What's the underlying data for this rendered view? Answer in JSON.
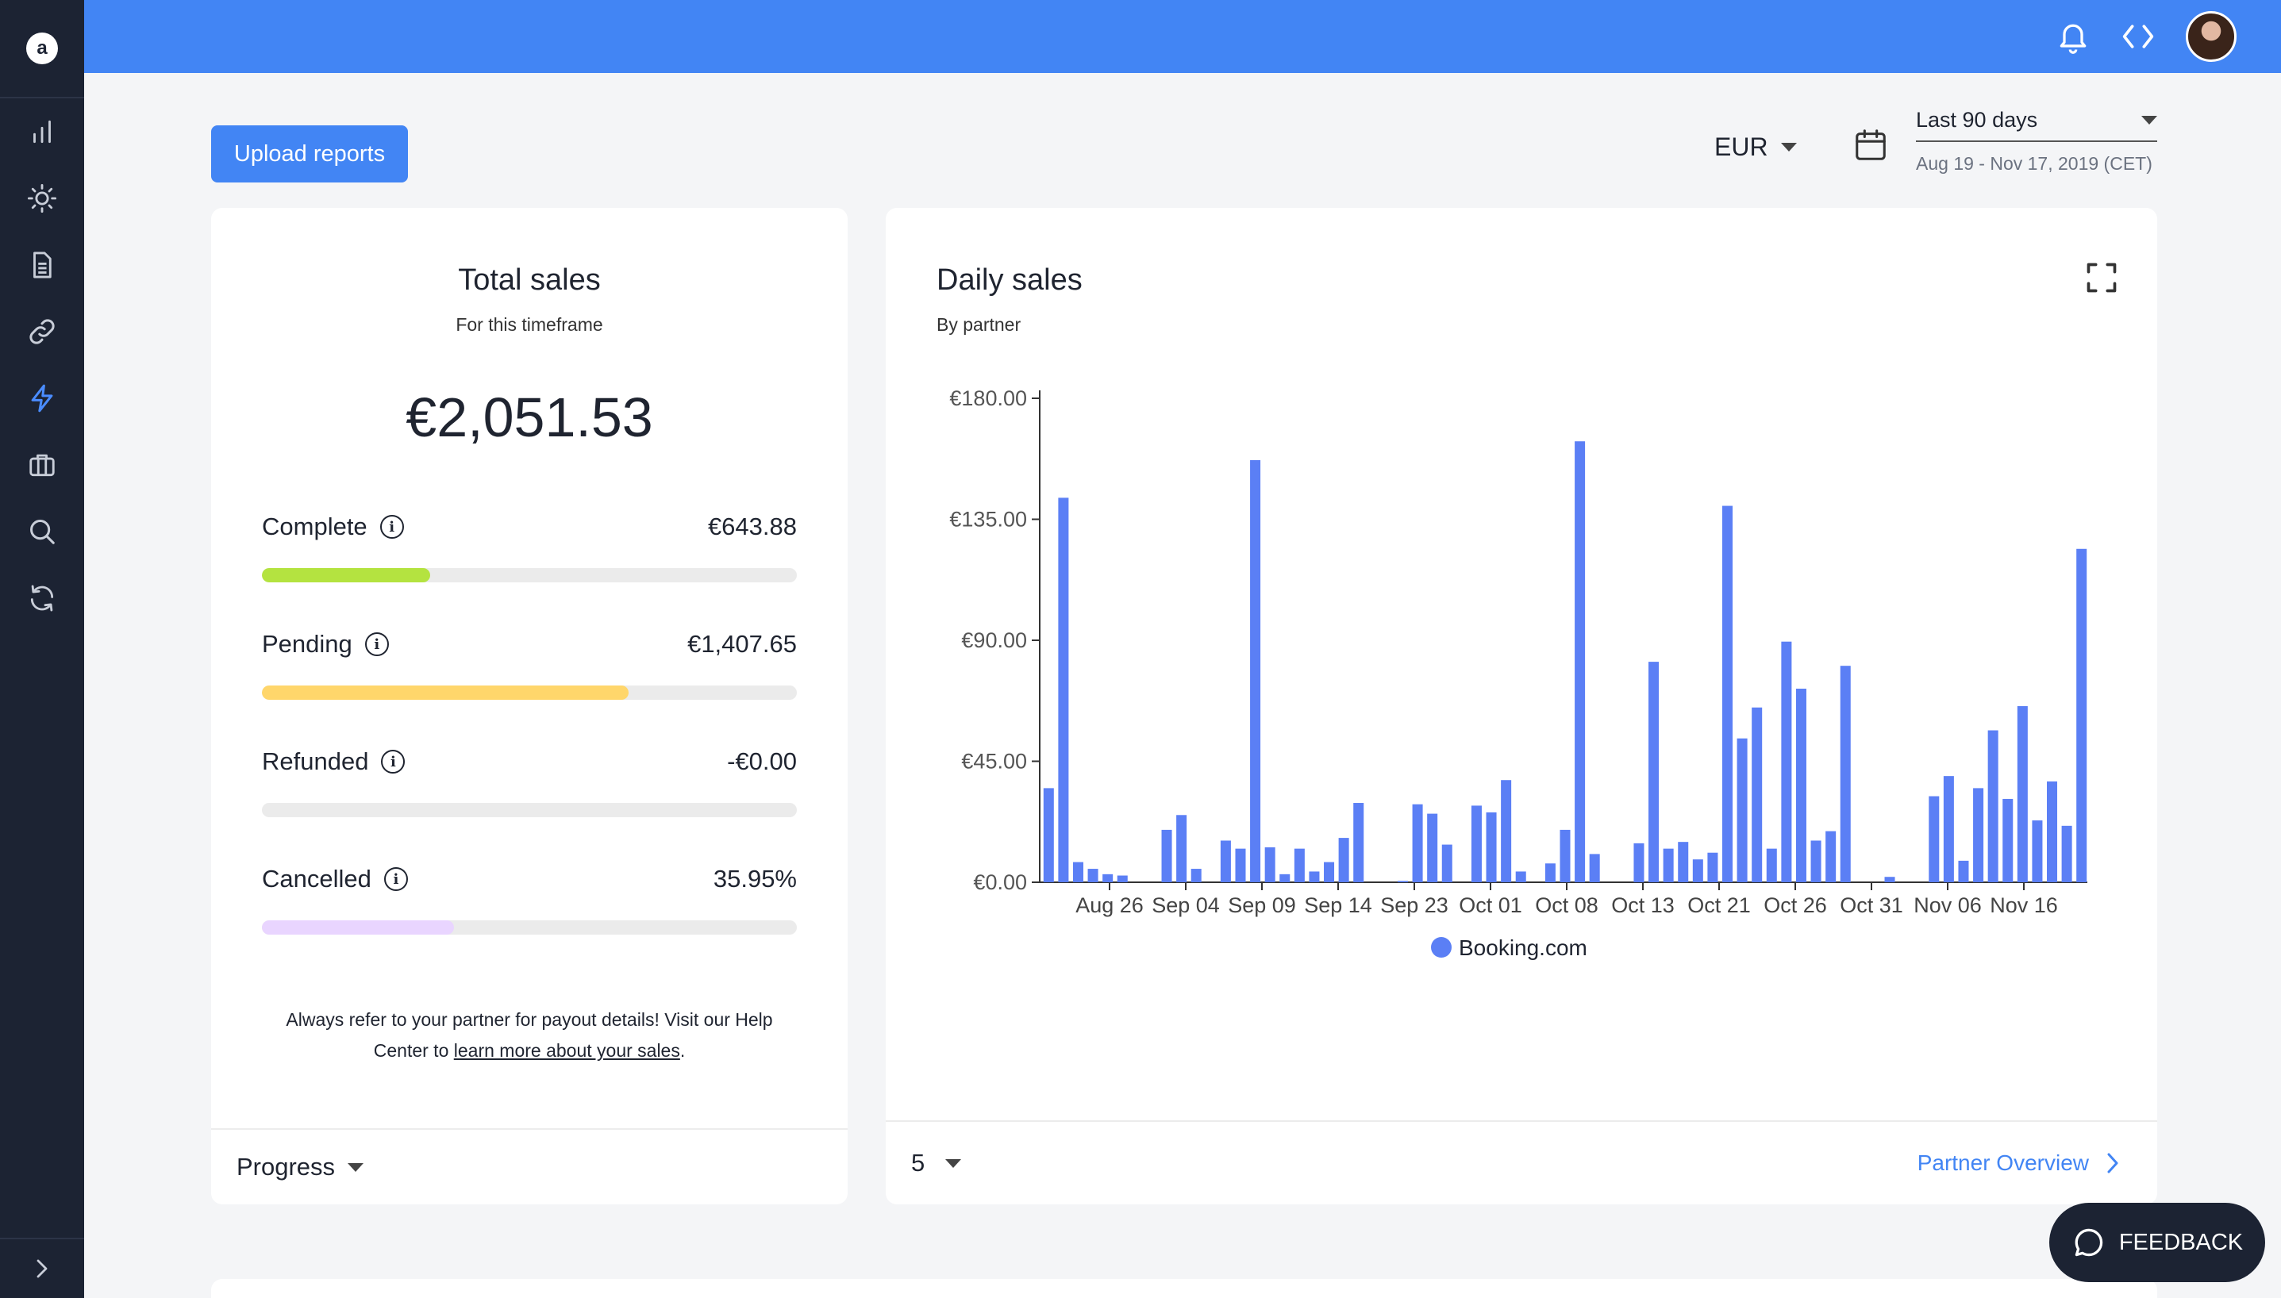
{
  "sidebar": {
    "logo": "a",
    "items": [
      {
        "icon": "bar-chart-icon"
      },
      {
        "icon": "sun-icon"
      },
      {
        "icon": "document-icon"
      },
      {
        "icon": "link-icon"
      },
      {
        "icon": "lightning-icon",
        "active": true
      },
      {
        "icon": "briefcase-icon"
      },
      {
        "icon": "search-icon"
      },
      {
        "icon": "refresh-icon"
      }
    ],
    "expand_icon": "chevron-right-icon"
  },
  "topbar": {
    "icons": [
      "bell-icon",
      "code-icon"
    ],
    "accent": "#4285f4"
  },
  "toolbar": {
    "upload_label": "Upload reports",
    "currency": "EUR",
    "date_range": "Last 90 days",
    "date_sub": "Aug 19 - Nov 17, 2019 (CET)"
  },
  "total": {
    "title": "Total sales",
    "subtitle": "For this timeframe",
    "amount": "€2,051.53",
    "metrics": [
      {
        "label": "Complete",
        "value": "€643.88",
        "fraction": 0.314,
        "color": "#b4e340"
      },
      {
        "label": "Pending",
        "value": "€1,407.65",
        "fraction": 0.686,
        "color": "#ffd66b"
      },
      {
        "label": "Refunded",
        "value": "-€0.00",
        "fraction": 0.0,
        "color": "#e0c8ff"
      },
      {
        "label": "Cancelled",
        "value": "35.95%",
        "fraction": 0.3595,
        "color": "#e9d5ff"
      }
    ],
    "note_text": "Always refer to your partner for payout details! Visit our Help Center to ",
    "note_link": "learn more about your sales",
    "note_end": ".",
    "footer_label": "Progress"
  },
  "daily": {
    "title": "Daily sales",
    "subtitle": "By partner",
    "page_size": "5",
    "partner_link": "Partner Overview"
  },
  "feedback": {
    "label": "FEEDBACK"
  },
  "chart_data": {
    "type": "bar",
    "title": "Daily sales",
    "subtitle": "By partner",
    "ylim": [
      0,
      180
    ],
    "y_ticks": [
      "€0.00",
      "€45.00",
      "€90.00",
      "€135.00",
      "€180.00"
    ],
    "x_tick_labels": [
      "Aug 26",
      "Sep 04",
      "Sep 09",
      "Sep 14",
      "Sep 23",
      "Oct 01",
      "Oct 08",
      "Oct 13",
      "Oct 21",
      "Oct 26",
      "Oct 31",
      "Nov 06",
      "Nov 16"
    ],
    "legend_position": "bottom",
    "series": [
      {
        "name": "Booking.com",
        "color": "#5b7ff5",
        "values": [
          35,
          143,
          7.5,
          5,
          3,
          2.5,
          0,
          0,
          19.5,
          25,
          5,
          0,
          15.5,
          12.5,
          157,
          13,
          3,
          12.5,
          4,
          7.5,
          16.5,
          29.5,
          0,
          0,
          0.5,
          29,
          25.5,
          14,
          0,
          28.5,
          26,
          38,
          4,
          0,
          7,
          19.5,
          164,
          10.5,
          0,
          0,
          14.5,
          82,
          12.5,
          15,
          8.5,
          11,
          140,
          53.5,
          65,
          12.5,
          89.5,
          72,
          15.5,
          19,
          80.5,
          0,
          0,
          2,
          0,
          0,
          32,
          39.5,
          8,
          35,
          56.5,
          31,
          65.5,
          23,
          37.5,
          21,
          124
        ]
      }
    ]
  }
}
